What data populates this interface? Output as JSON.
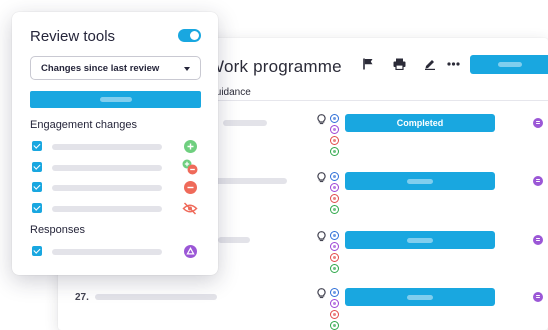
{
  "work_programme": {
    "title": "Work programme",
    "column_header": "Guidance",
    "toolbar_icons": [
      "flag-icon",
      "print-icon",
      "pen-icon",
      "more-icon"
    ],
    "rows": [
      {
        "number": "",
        "status_label": "Completed"
      },
      {
        "number": "",
        "status_label": ""
      },
      {
        "number": "",
        "status_label": ""
      },
      {
        "number": "27.",
        "status_label": ""
      }
    ]
  },
  "review_tools": {
    "title": "Review tools",
    "toggle_on": true,
    "filter_selected": "Changes since last review",
    "engagement_section": "Engagement changes",
    "engagement_items": [
      {
        "checked": true,
        "icon": "add-icon",
        "color": "#6fcf7f"
      },
      {
        "checked": true,
        "icon": "add-remove-icon",
        "color": "#6fcf7f"
      },
      {
        "checked": true,
        "icon": "remove-icon",
        "color": "#ef6a5a"
      },
      {
        "checked": true,
        "icon": "hidden-icon",
        "color": "#ef6a5a"
      }
    ],
    "responses_section": "Responses",
    "response_items": [
      {
        "checked": true,
        "icon": "triangle-alert-icon",
        "color": "#9b57d6"
      }
    ]
  },
  "colors": {
    "accent": "#19a7e0",
    "panel_bg": "#ffffff",
    "text": "#25253a"
  }
}
